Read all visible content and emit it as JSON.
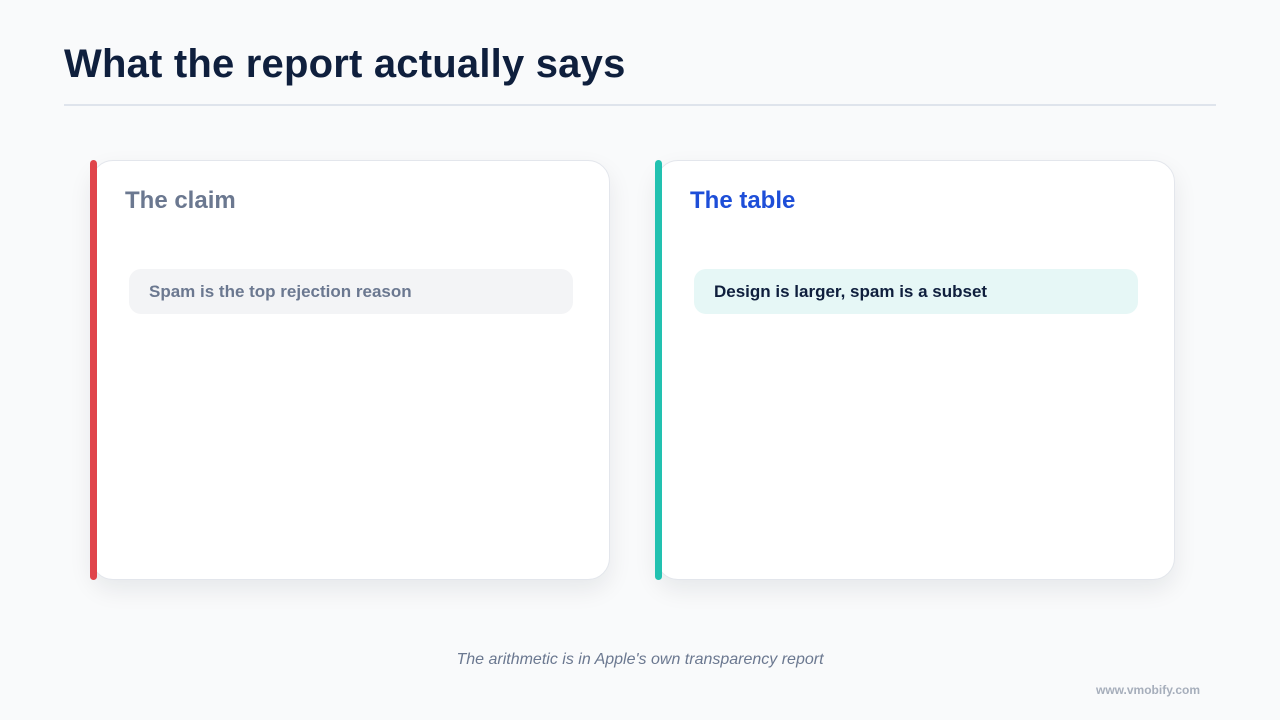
{
  "slide": {
    "title": "What the report actually says",
    "caption": "The arithmetic is in Apple's own transparency report",
    "brand": "www.vmobify.com"
  },
  "cards": [
    {
      "heading": "The claim",
      "pill": "Spam is the top rejection reason",
      "accent_color": "#e0454b",
      "heading_color": "#6b7890",
      "pill_bg": "#f3f4f6",
      "pill_text_color": "#6b7890"
    },
    {
      "heading": "The table",
      "pill": "Design is larger, spam is a subset",
      "accent_color": "#22c1b0",
      "heading_color": "#1d4ed8",
      "pill_bg": "#e6f7f6",
      "pill_text_color": "#0f1f3d"
    }
  ]
}
